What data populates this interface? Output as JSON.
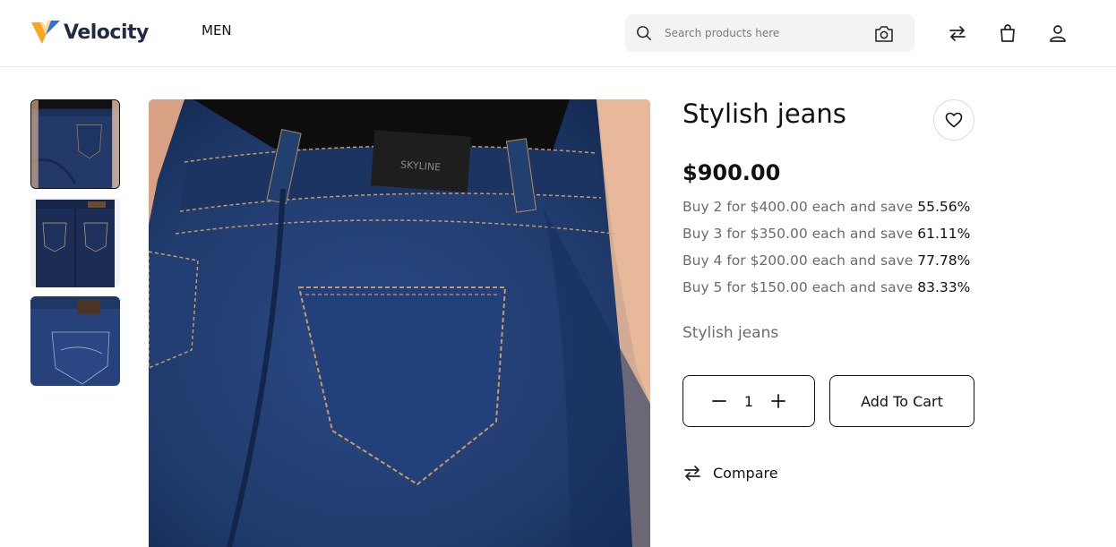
{
  "header": {
    "brand": "Velocity",
    "nav": {
      "men_label": "MEN"
    },
    "search": {
      "placeholder": "Search products here"
    },
    "icons": [
      "search-icon",
      "camera-icon",
      "compare-arrows-icon",
      "shopping-bag-icon",
      "user-icon"
    ]
  },
  "product": {
    "title": "Stylish jeans",
    "price": "$900.00",
    "tiers": [
      {
        "text": "Buy 2 for $400.00 each and save",
        "pct": "55.56%"
      },
      {
        "text": "Buy 3 for $350.00 each and save",
        "pct": "61.11%"
      },
      {
        "text": "Buy 4 for $200.00 each and save",
        "pct": "77.78%"
      },
      {
        "text": "Buy 5 for $150.00 each and save",
        "pct": "83.33%"
      }
    ],
    "description": "Stylish jeans",
    "quantity": "1",
    "add_to_cart_label": "Add To Cart",
    "compare_label": "Compare",
    "thumbnail_count": 3,
    "active_thumbnail": 1
  },
  "colors": {
    "denim": "#1f3a6b",
    "denim_dark": "#16284d",
    "brand_navy": "#1f2a44",
    "logo_orange": "#f5a623",
    "logo_blue": "#2f6fe0"
  }
}
